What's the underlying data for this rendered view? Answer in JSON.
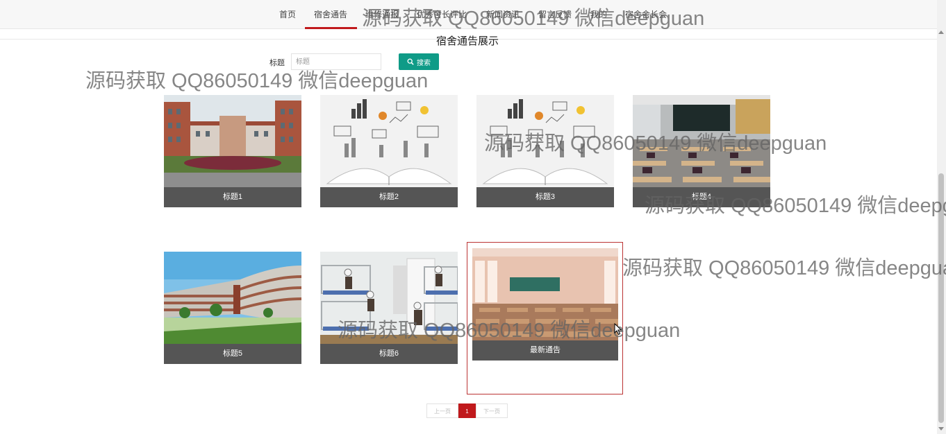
{
  "nav": {
    "items": [
      {
        "label": "首页"
      },
      {
        "label": "宿舍通告"
      },
      {
        "label": "维修通报"
      },
      {
        "label": "优秀舍长评比"
      },
      {
        "label": "新闻资讯"
      },
      {
        "label": "留言反馈"
      },
      {
        "label": "我的"
      },
      {
        "label": "宿舍舍长会"
      }
    ],
    "active_index": 1
  },
  "page": {
    "title": "宿舍通告展示"
  },
  "search": {
    "label": "标题",
    "placeholder": "标题",
    "button_label": "搜索"
  },
  "cards": [
    {
      "title": "标题1",
      "image": "school-campus-photo"
    },
    {
      "title": "标题2",
      "image": "open-book-illustration"
    },
    {
      "title": "标题3",
      "image": "open-book-illustration"
    },
    {
      "title": "标题4",
      "image": "classroom-photo"
    },
    {
      "title": "标题5",
      "image": "campus-courtyard-photo"
    },
    {
      "title": "标题6",
      "image": "dormitory-room-photo"
    },
    {
      "title": "最新通告",
      "image": "anime-classroom-illustration"
    }
  ],
  "pagination": {
    "prev": "上一页",
    "current": "1",
    "next": "下一页"
  },
  "watermark": {
    "text": "源码获取 QQ86050149 微信deepguan"
  },
  "colors": {
    "accent_red": "#c0191c",
    "search_green": "#0f9b87",
    "caption_bg": "#555555"
  }
}
